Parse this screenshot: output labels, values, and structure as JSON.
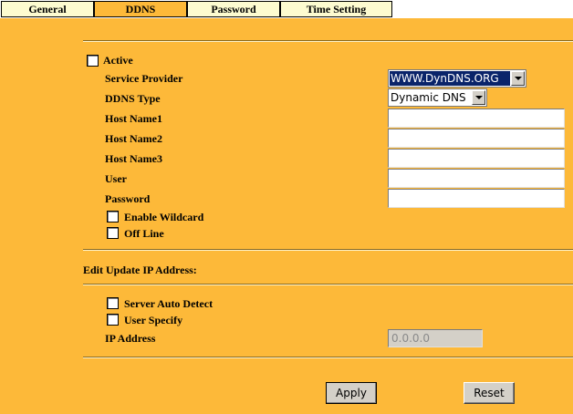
{
  "tabs": [
    {
      "label": "General",
      "active": false
    },
    {
      "label": "DDNS",
      "active": true
    },
    {
      "label": "Password",
      "active": false
    },
    {
      "label": "Time Setting",
      "active": false
    }
  ],
  "ddns": {
    "active_label": "Active",
    "service_provider_label": "Service Provider",
    "service_provider_value": "WWW.DynDNS.ORG",
    "ddns_type_label": "DDNS Type",
    "ddns_type_value": "Dynamic DNS",
    "host_name1_label": "Host Name1",
    "host_name2_label": "Host Name2",
    "host_name3_label": "Host Name3",
    "user_label": "User",
    "password_label": "Password",
    "enable_wildcard_label": "Enable Wildcard",
    "off_line_label": "Off Line"
  },
  "update_ip": {
    "section_title": "Edit Update IP Address:",
    "server_auto_detect_label": "Server Auto Detect",
    "user_specify_label": "User Specify",
    "ip_address_label": "IP Address",
    "ip_address_value": "0.0.0.0"
  },
  "buttons": {
    "apply": "Apply",
    "reset": "Reset"
  },
  "colors": {
    "page_background": "#fdb939",
    "inactive_tab": "#fdfbd0"
  }
}
